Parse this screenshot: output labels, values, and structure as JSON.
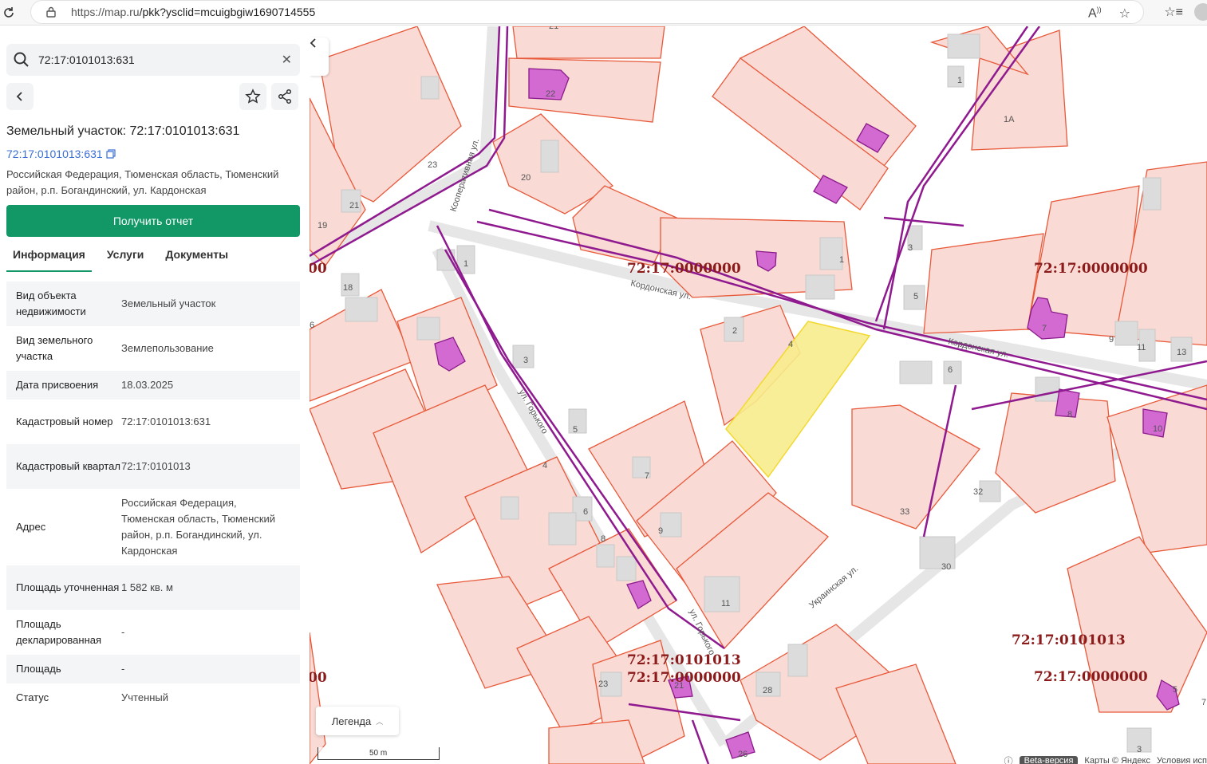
{
  "browser": {
    "url_host": "https://map.ru",
    "url_path": "/pkk?ysclid=mcuigbgiw1690714555"
  },
  "search": {
    "value": "72:17:0101013:631"
  },
  "parcel": {
    "title": "Земельный участок: 72:17:0101013:631",
    "cad_link": "72:17:0101013:631",
    "address": "Российская Федерация, Тюменская область, Тюменский район, р.п. Богандинский, ул. Кардонская"
  },
  "report_button": "Получить отчет",
  "tabs": [
    "Информация",
    "Услуги",
    "Документы"
  ],
  "info_rows": [
    {
      "key": "Вид объекта недвижимости",
      "value": "Земельный участок"
    },
    {
      "key": "Вид земельного участка",
      "value": "Землепользование"
    },
    {
      "key": "Дата присвоения",
      "value": "18.03.2025"
    },
    {
      "key": "Кадастровый номер",
      "value": "72:17:0101013:631"
    },
    {
      "key": "Кадастровый квартал",
      "value": "72:17:0101013"
    },
    {
      "key": "Адрес",
      "value": "Российская Федерация, Тюменская область, Тюменский район, р.п. Богандинский, ул. Кардонская"
    },
    {
      "key": "Площадь уточненная",
      "value": "1 582 кв. м"
    },
    {
      "key": "Площадь декларированная",
      "value": "-"
    },
    {
      "key": "Площадь",
      "value": "-"
    },
    {
      "key": "Статус",
      "value": "Учтенный"
    }
  ],
  "map": {
    "quarter_labels": {
      "q1": "72:17:0000000",
      "q2": "72:17:0000000",
      "q3": "72:17:0101013",
      "q4": "72:17:0000000",
      "q5": "72:17:0101013",
      "q6": "72:17:0000000",
      "q7": "00",
      "q8": "00"
    },
    "streets": {
      "kooperativnaya": "Кооперативная ул.",
      "kordonskaya1": "Кордонская ул.",
      "kordonskaya2": "Кордонская ул.",
      "gorkogo1": "ул. Горького",
      "gorkogo2": "ул. Горького",
      "ukrainskaya": "Украинская ул."
    },
    "legend_label": "Легенда",
    "scale_label": "50 m",
    "beta_label": "Beta-версия",
    "attribution": "Карты © Яндекс",
    "terms": "Условия исп",
    "selection_color": "#f7ec8c"
  }
}
